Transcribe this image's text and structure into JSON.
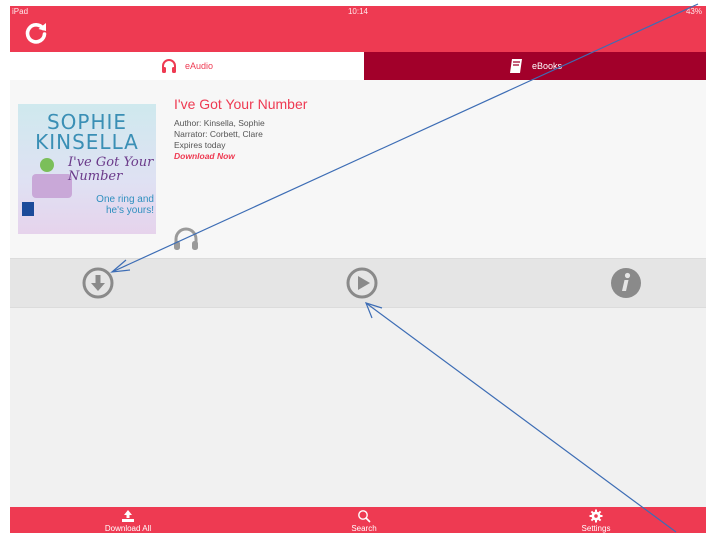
{
  "status_bar": {
    "device": "iPad",
    "time": "10:14",
    "battery": "43%"
  },
  "tabs": [
    {
      "label": "eAudio",
      "icon": "headphones-icon",
      "active": true
    },
    {
      "label": "eBooks",
      "icon": "book-icon",
      "active": false
    }
  ],
  "book": {
    "title": "I've Got Your Number",
    "author": "Author: Kinsella, Sophie",
    "narrator": "Narrator: Corbett, Clare",
    "expires": "Expires today",
    "action_link": "Download Now",
    "cover": {
      "author_line1": "SOPHIE",
      "author_line2": "KINSELLA",
      "title": "I've Got Your Number",
      "tagline": "One ring and he's yours!"
    }
  },
  "actions": [
    {
      "name": "download-button",
      "icon": "download-arrow-icon"
    },
    {
      "name": "play-button",
      "icon": "play-icon"
    },
    {
      "name": "info-button",
      "icon": "info-icon"
    }
  ],
  "bottom_nav": {
    "download_all": "Download All",
    "search": "Search",
    "settings": "Settings"
  },
  "colors": {
    "brand": "#ee3a52",
    "tab_inactive": "#a2002a",
    "icon_gray": "#8a8a8a",
    "annotation": "#3d6db5"
  }
}
